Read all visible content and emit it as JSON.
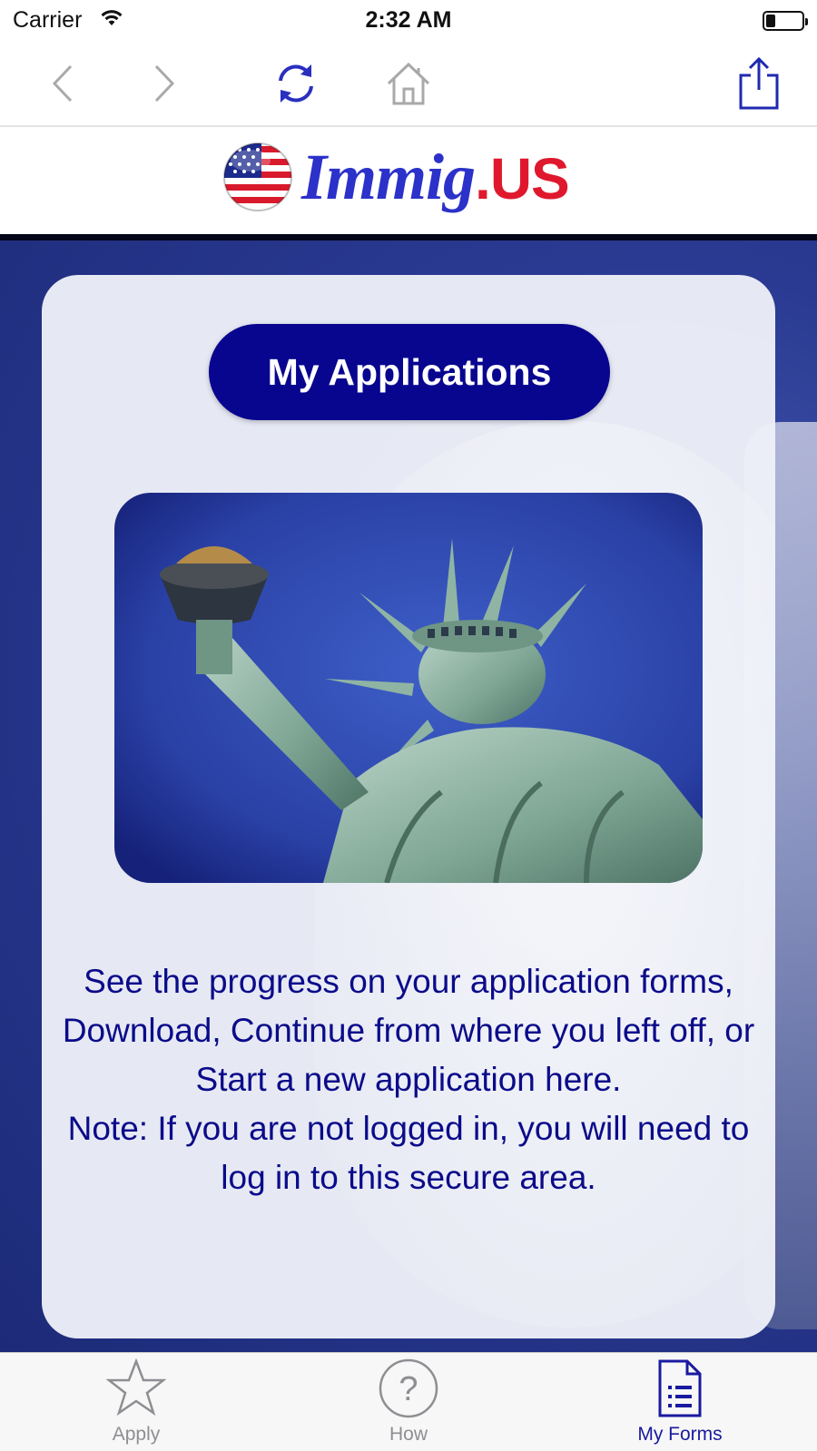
{
  "status_bar": {
    "carrier": "Carrier",
    "time": "2:32 AM",
    "battery_level": 0.3
  },
  "toolbar": {
    "icons": [
      "back-icon",
      "forward-icon",
      "refresh-icon",
      "home-icon",
      "share-icon"
    ]
  },
  "header": {
    "logo_part1": "Immig",
    "logo_part2": ".US"
  },
  "card": {
    "button_label": "My Applications",
    "description": "See the progress on your application forms, Download, Continue from where you left off, or Start a new application here.",
    "note": "Note: If you are not logged in, you will need to log in to this secure area."
  },
  "tabs": [
    {
      "label": "Apply",
      "icon": "star-icon",
      "active": false
    },
    {
      "label": "How",
      "icon": "question-icon",
      "active": false
    },
    {
      "label": "My Forms",
      "icon": "document-list-icon",
      "active": true
    }
  ],
  "colors": {
    "brand_blue": "#08068f",
    "text_blue": "#0b0b8a",
    "logo_red": "#e0182d",
    "active_tab": "#1a1aa0"
  }
}
